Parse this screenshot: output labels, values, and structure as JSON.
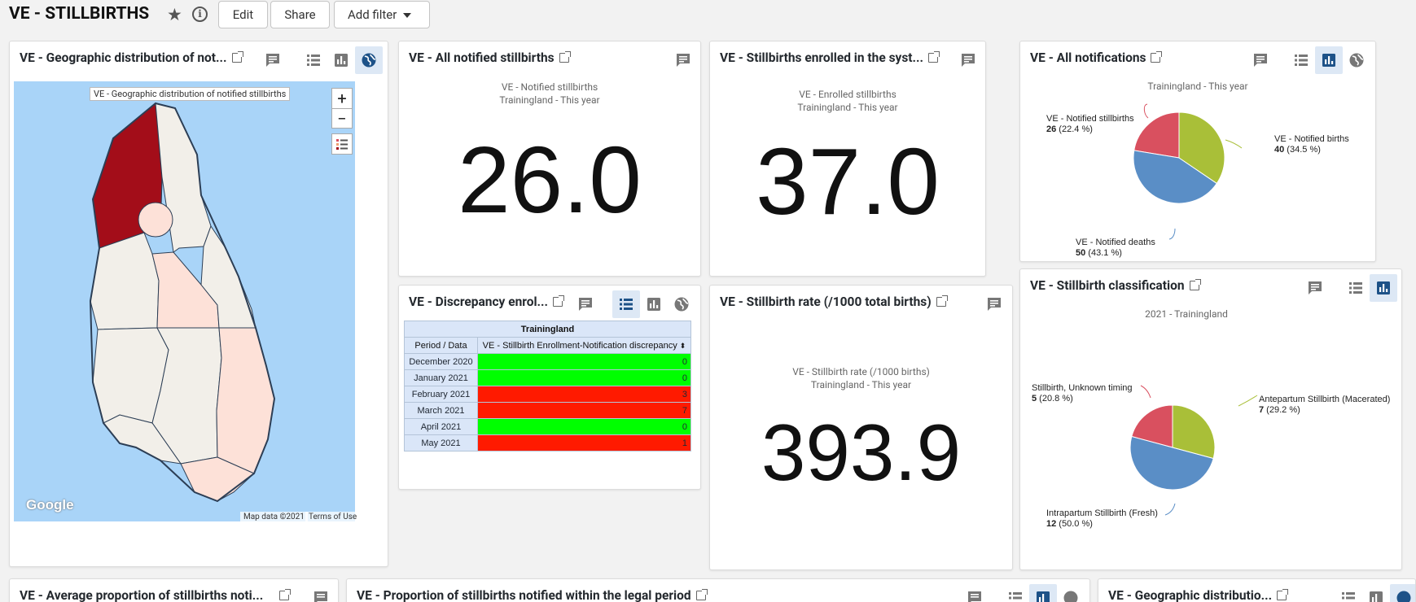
{
  "header": {
    "title": "VE - STILLBIRTHS",
    "edit_label": "Edit",
    "share_label": "Share",
    "add_filter_label": "Add filter"
  },
  "colors": {
    "active_icon_bg": "#dde8f5",
    "map_highlight": "#a30d19",
    "map_light": "#fde1d8",
    "map_neutral": "#f2efe9",
    "green": "#00ff00",
    "red": "#ff1a00",
    "pie_green": "#a9bf38",
    "pie_blue": "#5a8ec6",
    "pie_red": "#d9505f"
  },
  "cards": {
    "geo_map": {
      "title": "VE - Geographic distribution of not...",
      "map_label": "VE - Geographic distribution of notified stillbirths",
      "zoom_in": "+",
      "zoom_out": "−",
      "google": "Google",
      "map_data": "Map data ©2021",
      "terms": "Terms of Use"
    },
    "all_notified": {
      "title": "VE - All notified stillbirths",
      "subtitle_1": "VE - Notified stillbirths",
      "subtitle_2": "Trainingland - This year",
      "value": "26.0"
    },
    "enrolled": {
      "title": "VE - Stillbirths enrolled in the syst...",
      "subtitle_1": "VE - Enrolled stillbirths",
      "subtitle_2": "Trainingland - This year",
      "value": "37.0"
    },
    "all_notifications": {
      "title": "VE - All notifications",
      "subtitle": "Trainingland - This year"
    },
    "discrepancy": {
      "title": "VE - Discrepancy enrol...",
      "table_header": "Trainingland",
      "col_period": "Period / Data",
      "col_data": "VE - Stillbirth Enrollment-Notification discrepancy",
      "sort_icon": "⬍",
      "rows": [
        {
          "period": "December 2020",
          "value": "0",
          "status": "green"
        },
        {
          "period": "January 2021",
          "value": "0",
          "status": "green"
        },
        {
          "period": "February 2021",
          "value": "3",
          "status": "red"
        },
        {
          "period": "March 2021",
          "value": "7",
          "status": "red"
        },
        {
          "period": "April 2021",
          "value": "0",
          "status": "green"
        },
        {
          "period": "May 2021",
          "value": "1",
          "status": "red"
        }
      ]
    },
    "rate": {
      "title": "VE - Stillbirth rate (/1000 total births)",
      "subtitle_1": "VE - Stillbirth rate (/1000 births)",
      "subtitle_2": "Trainingland - This year",
      "value": "393.9"
    },
    "classification": {
      "title": "VE - Stillbirth classification",
      "subtitle": "2021 - Trainingland"
    },
    "avg_proportion": {
      "title": "VE - Average proportion of stillbirths noti..."
    },
    "proportion_legal": {
      "title": "VE - Proportion of stillbirths notified within the legal period"
    },
    "geo_bottom": {
      "title": "VE - Geographic distributio..."
    }
  },
  "chart_data": [
    {
      "type": "pie",
      "title": "Trainingland - This year",
      "slices": [
        {
          "name": "VE - Notified births",
          "value": 40,
          "pct": "34.5 %",
          "color": "#a9bf38"
        },
        {
          "name": "VE - Notified deaths",
          "value": 50,
          "pct": "43.1 %",
          "color": "#5a8ec6"
        },
        {
          "name": "VE - Notified stillbirths",
          "value": 26,
          "pct": "22.4 %",
          "color": "#d9505f"
        }
      ]
    },
    {
      "type": "pie",
      "title": "2021 - Trainingland",
      "slices": [
        {
          "name": "Antepartum Stillbirth (Macerated)",
          "value": 7,
          "pct": "29.2 %",
          "color": "#a9bf38"
        },
        {
          "name": "Intrapartum Stillbirth (Fresh)",
          "value": 12,
          "pct": "50.0 %",
          "color": "#5a8ec6"
        },
        {
          "name": "Stillbirth, Unknown timing",
          "value": 5,
          "pct": "20.8 %",
          "color": "#d9505f"
        }
      ]
    }
  ]
}
